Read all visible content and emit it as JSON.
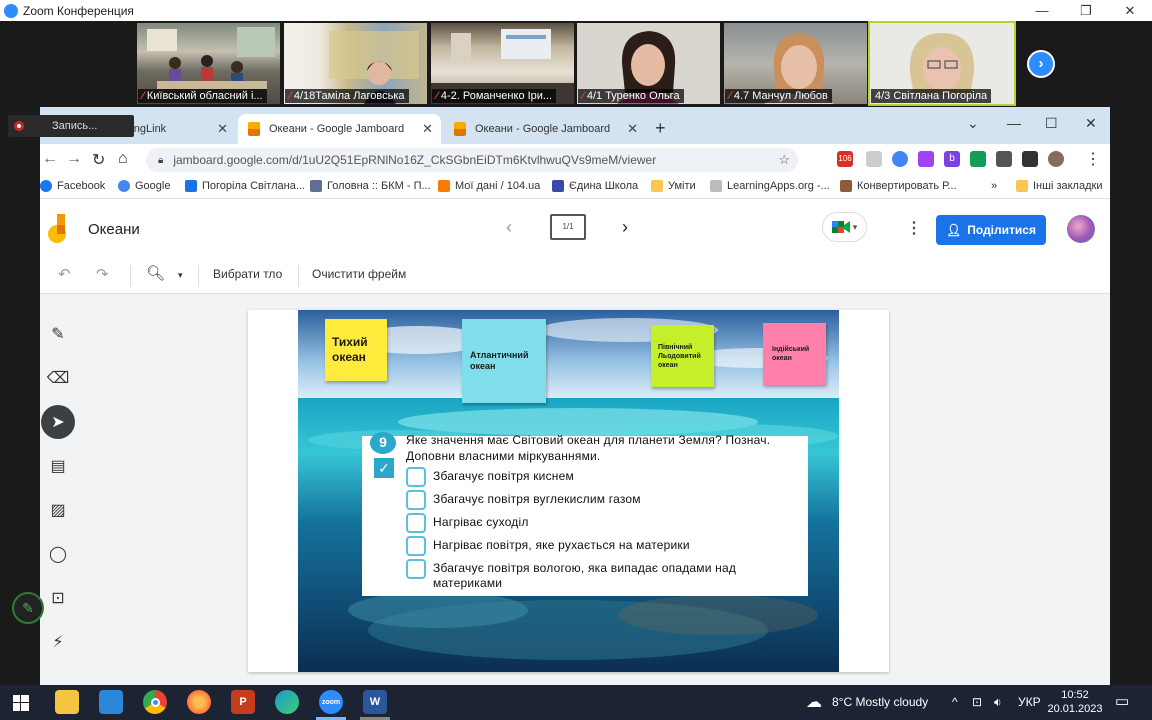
{
  "zoom": {
    "window_title": "Zoom Конференция",
    "participants": [
      {
        "label": "Київський обласний і..."
      },
      {
        "label": "4/18Таміла Лаговська"
      },
      {
        "label": "4-2. Романченко Іри..."
      },
      {
        "label": "4/1 Туренко Ольга"
      },
      {
        "label": "4.7 Манчул Любов"
      },
      {
        "label": "4/3 Світлана Погоріла"
      }
    ],
    "recording_label": "Запись..."
  },
  "browser": {
    "tabs": [
      {
        "label": "Oceans - ThingLink"
      },
      {
        "label": "Океани - Google Jamboard"
      },
      {
        "label": "Океани - Google Jamboard"
      }
    ],
    "url": "jamboard.google.com/d/1uU2Q51EpRNlNo16Z_CkSGbnEiDTm6KtvlhwuQVs9meM/viewer",
    "gmail_badge": "106",
    "bookmarks": [
      {
        "label": "Facebook"
      },
      {
        "label": "Google"
      },
      {
        "label": "Погоріла Світлана..."
      },
      {
        "label": "Головна :: БКМ - П..."
      },
      {
        "label": "Мої дані / 104.ua"
      },
      {
        "label": "Єдина Школа"
      },
      {
        "label": "Уміти"
      },
      {
        "label": "LearningApps.org -..."
      },
      {
        "label": "Конвертировать Р..."
      }
    ],
    "bookmarks_more": "»",
    "other_bookmarks": "Інші закладки"
  },
  "jamboard": {
    "title": "Океани",
    "frame_counter": "1/1",
    "share_label": "Поділитися",
    "toolbar": {
      "set_background": "Вибрати тло",
      "clear_frame": "Очистити фрейм"
    },
    "stickies": [
      {
        "text": "Тихий океан",
        "color": "#ffeb3b"
      },
      {
        "text": "Атлантичний океан",
        "color": "#80deea"
      },
      {
        "text": "Північний Льодовитий океан",
        "color": "#c6ef2b"
      },
      {
        "text": "Індійський океан",
        "color": "#ff80ab"
      }
    ],
    "worksheet": {
      "number": "9",
      "question": "Яке значення має Світовий океан для планети Земля? Познач. Доповни власними міркуваннями.",
      "options": [
        "Збагачує повітря киснем",
        "Збагачує повітря вуглекислим газом",
        "Нагріває суходіл",
        "Нагріває повітря, яке рухається на материки",
        "Збагачує повітря вологою, яка випадає опадами над материками"
      ]
    }
  },
  "taskbar": {
    "weather": "8°C  Mostly cloudy",
    "lang": "УКР",
    "time": "10:52",
    "date": "20.01.2023",
    "apps": [
      {
        "icon": "file-explorer-icon",
        "color": "#f5c542"
      },
      {
        "icon": "store-icon",
        "color": "#2b88d8"
      },
      {
        "icon": "chrome-icon",
        "color": "#34a853"
      },
      {
        "icon": "firefox-icon",
        "color": "#ff7139"
      },
      {
        "icon": "powerpoint-icon",
        "color": "#c43e1c",
        "text": "P"
      },
      {
        "icon": "edge-icon",
        "color": "#1d9bd1"
      },
      {
        "icon": "zoom-icon",
        "color": "#2d8cff",
        "text": "zoom"
      },
      {
        "icon": "word-icon",
        "color": "#2b579a",
        "text": "W"
      }
    ]
  }
}
